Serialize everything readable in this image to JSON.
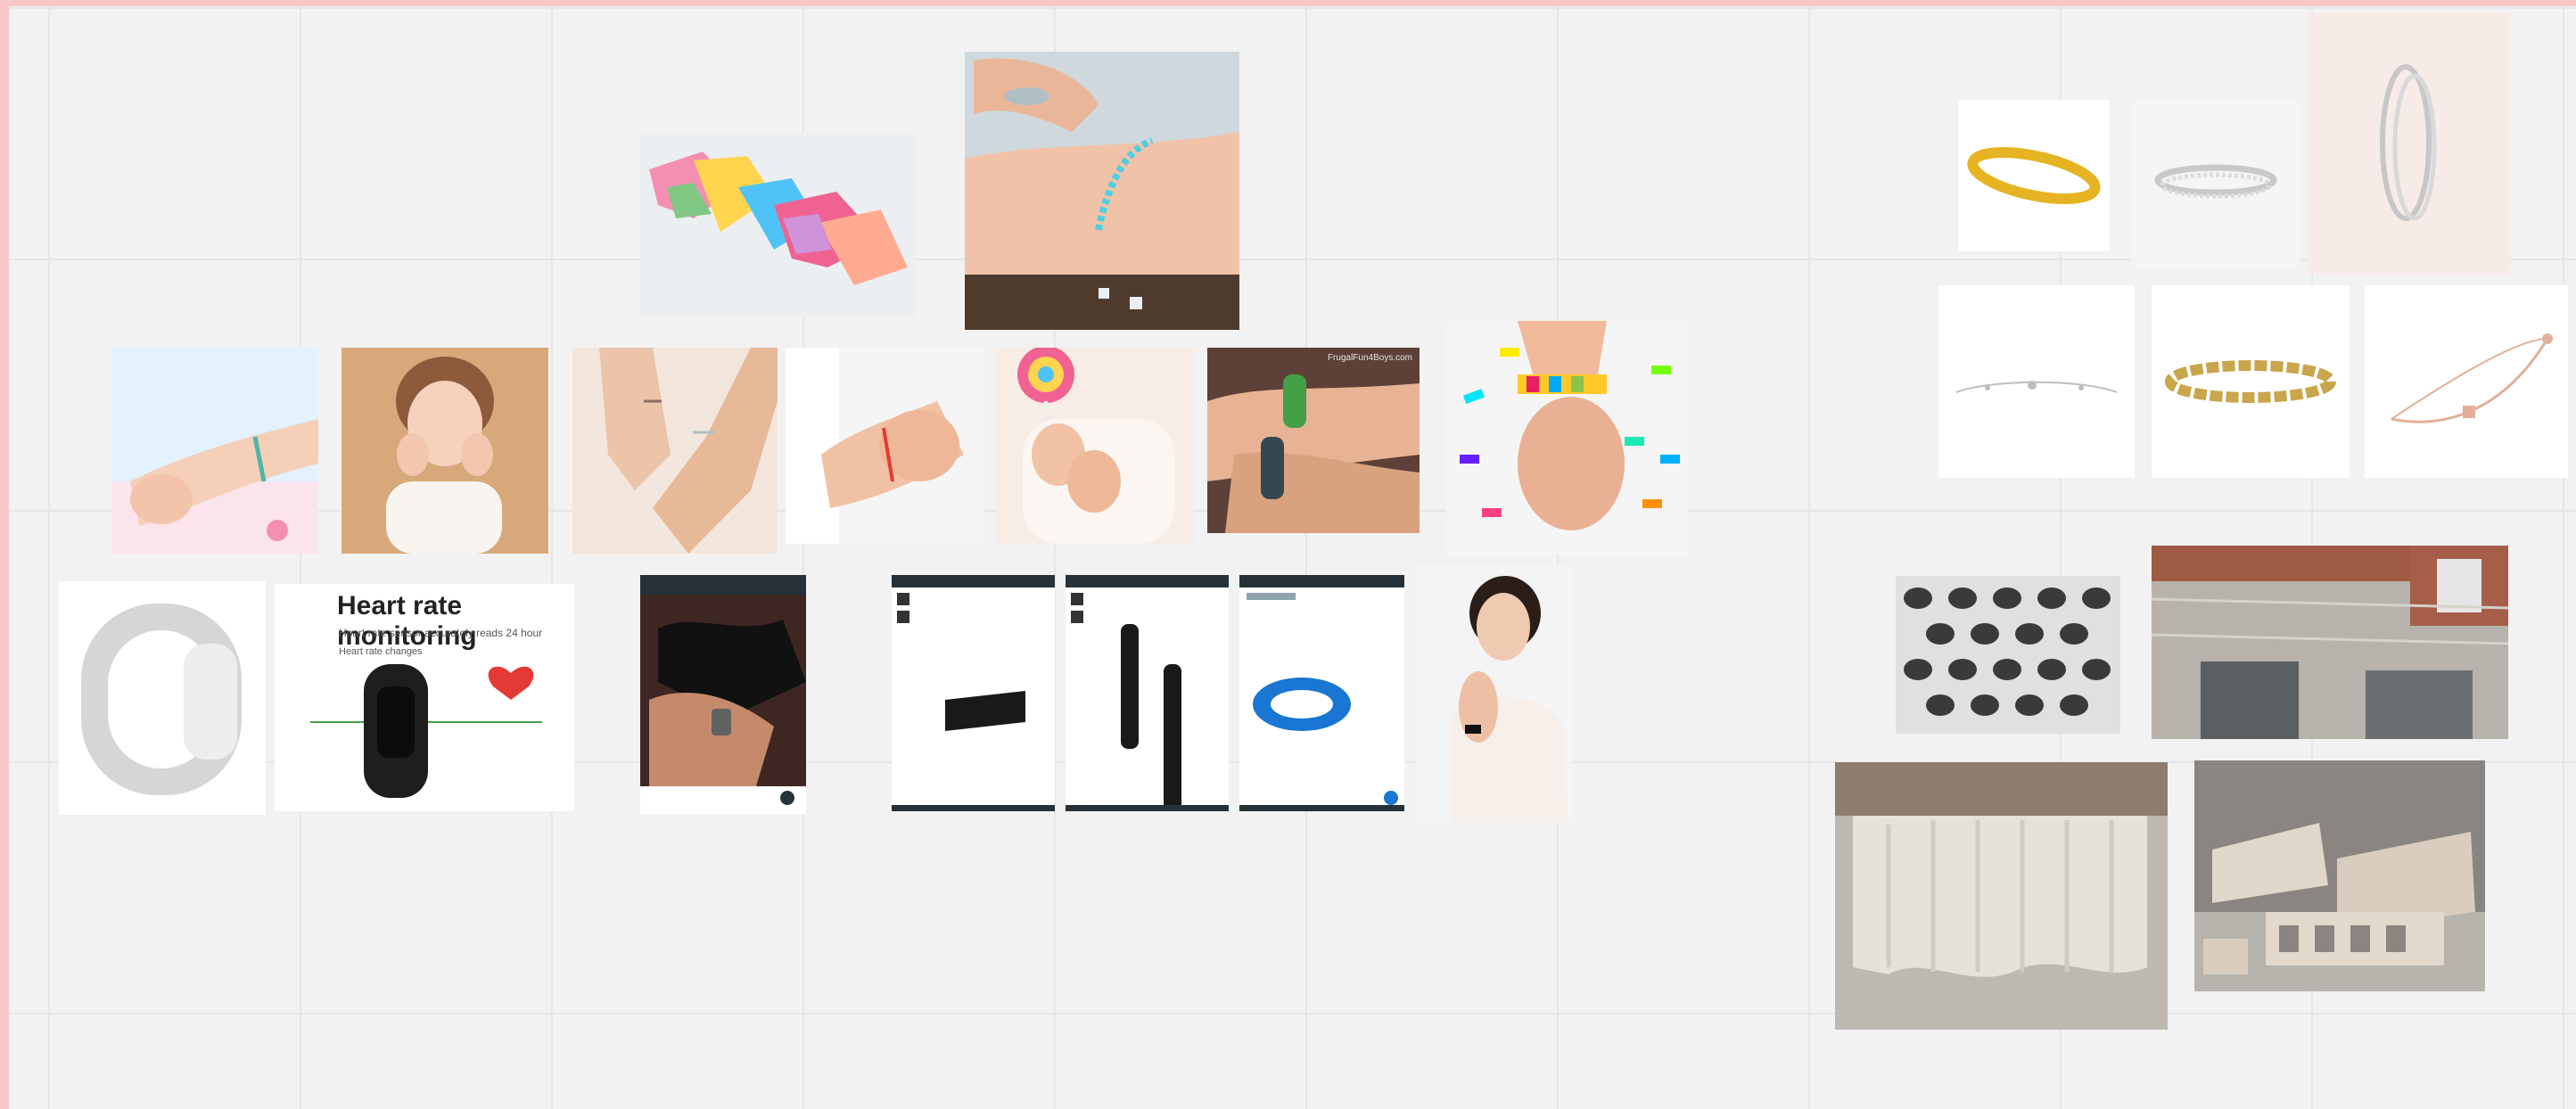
{
  "board": {
    "title": "",
    "colors": {
      "background": "#f2f2f2",
      "grid": "#e6e6e6",
      "frame": "#f8c7c6"
    }
  },
  "cards": {
    "origami_bracelets": {
      "icon": "origami-bracelets-image"
    },
    "hand_bracelet_dice": {
      "icon": "hand-bracelet-photo"
    },
    "child_arm_bracelet": {
      "icon": "child-arm-bracelet-photo"
    },
    "girl_portrait": {
      "icon": "girl-portrait-photo"
    },
    "child_hands_1": {
      "icon": "child-hands-photo"
    },
    "child_hands_2": {
      "icon": "child-hands-red-string-photo"
    },
    "lollipop_child": {
      "icon": "lollipop-child-photo"
    },
    "paracord_kids": {
      "icon": "paracord-bracelets-photo",
      "watermark": "FrugalFun4Boys.com"
    },
    "bead_bracelet_kid": {
      "icon": "bead-bracelet-kid-photo"
    },
    "mosquito_band": {
      "icon": "mosquito-band-product"
    },
    "heart_rate_ad": {
      "icon": "fitness-band-product",
      "title": "Heart rate monitoring",
      "subtitle": "Heart rate sensor accurately reads 24 hour",
      "subtitle2": "Heart rate changes"
    },
    "phone_watch_photo": {
      "icon": "smartwatch-phone-screenshot"
    },
    "phone_black_band": {
      "icon": "black-band-phone-screenshot"
    },
    "phone_two_straps": {
      "icon": "two-straps-phone-screenshot"
    },
    "phone_blue_band": {
      "icon": "blue-band-phone-screenshot"
    },
    "woman_watch": {
      "icon": "woman-with-watch-photo"
    },
    "gold_bangle": {
      "icon": "gold-bangle-product"
    },
    "silver_diamond_bracelet": {
      "icon": "silver-diamond-bracelet-product"
    },
    "double_bangle": {
      "icon": "double-bangle-product"
    },
    "chain_bracelet": {
      "icon": "chain-bracelet-product"
    },
    "tennis_bracelet": {
      "icon": "tennis-bracelet-product"
    },
    "rose_gold_slider": {
      "icon": "rose-gold-slider-bracelet-product"
    },
    "perforated_facade": {
      "icon": "perforated-facade-photo"
    },
    "textured_building": {
      "icon": "textured-building-photo"
    },
    "ceramic_wave_wall": {
      "icon": "ceramic-wave-wall-photo"
    },
    "ceramic_blocks": {
      "icon": "ceramic-blocks-photo"
    }
  }
}
